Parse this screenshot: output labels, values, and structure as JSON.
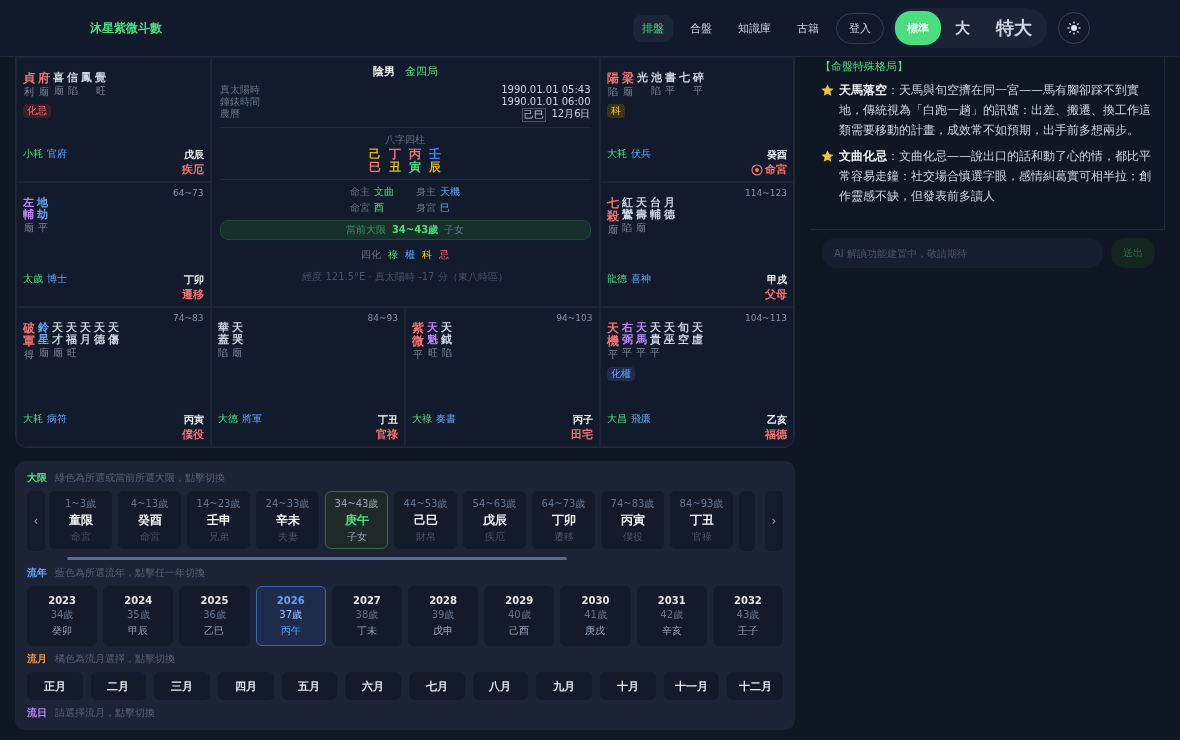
{
  "header": {
    "logo": "沐星紫微斗數",
    "nav": [
      {
        "label": "排盤",
        "selected": true
      },
      {
        "label": "合盤",
        "selected": false
      },
      {
        "label": "知識庫",
        "selected": false
      },
      {
        "label": "古籍",
        "selected": false
      }
    ],
    "login": "登入",
    "font_sizes": [
      {
        "label": "標準",
        "selected": true
      },
      {
        "label": "大",
        "selected": false
      },
      {
        "label": "特大",
        "selected": false
      }
    ]
  },
  "chart": {
    "palaces": [
      {
        "stars": [
          {
            "name": "貞",
            "kind": "main",
            "brightness": "利"
          },
          {
            "name": "府",
            "kind": "main",
            "brightness": "廟"
          },
          {
            "name": "喜",
            "kind": "minor",
            "brightness": "廟"
          },
          {
            "name": "信",
            "kind": "minor",
            "brightness": "陷"
          },
          {
            "name": "鳳",
            "kind": "minor"
          },
          {
            "name": "覺",
            "kind": "minor",
            "brightness": "旺"
          }
        ],
        "badge": {
          "text": "化忌",
          "kind": "ji"
        },
        "spirits": [
          "小耗",
          "官府"
        ],
        "stem_branch": "戊辰",
        "name": "疾厄",
        "life_palace": false
      },
      {
        "stars": [
          {
            "name": "陽",
            "kind": "main",
            "brightness": "陷"
          },
          {
            "name": "梁",
            "kind": "main",
            "brightness": "廟"
          },
          {
            "name": "光",
            "kind": "minor"
          },
          {
            "name": "池",
            "kind": "minor",
            "brightness": "陷"
          },
          {
            "name": "書",
            "kind": "minor",
            "brightness": "平"
          },
          {
            "name": "七",
            "kind": "minor"
          },
          {
            "name": "碎",
            "kind": "minor",
            "brightness": "平"
          }
        ],
        "badge": {
          "text": "科",
          "kind": "ke"
        },
        "spirits": [
          "大耗",
          "伏兵"
        ],
        "stem_branch": "癸酉",
        "name": "命宮",
        "life_palace": true
      },
      {
        "age": "64~73",
        "stars": [
          {
            "name": "左輔",
            "kind": "lucky",
            "brightness": "廟"
          },
          {
            "name": "地劫",
            "kind": "evil",
            "brightness": "平"
          }
        ],
        "spirits": [
          "太歲",
          "博士"
        ],
        "stem_branch": "丁卯",
        "name": "遷移",
        "life_palace": false
      },
      {
        "age": "114~123",
        "stars": [
          {
            "name": "七殺",
            "kind": "main",
            "brightness": "廟"
          },
          {
            "name": "紅鸞",
            "kind": "minor",
            "brightness": "陷"
          },
          {
            "name": "天壽",
            "kind": "minor",
            "brightness": "廟"
          },
          {
            "name": "台輔",
            "kind": "minor"
          },
          {
            "name": "月德",
            "kind": "minor"
          }
        ],
        "spirits": [
          "龍德",
          "喜神"
        ],
        "stem_branch": "甲戌",
        "name": "父母",
        "life_palace": false
      },
      {
        "age": "74~83",
        "stars": [
          {
            "name": "破軍",
            "kind": "main",
            "brightness": "得"
          },
          {
            "name": "鈴星",
            "kind": "evil",
            "brightness": "廟"
          },
          {
            "name": "天才",
            "kind": "minor",
            "brightness": "廟"
          },
          {
            "name": "天福",
            "kind": "minor",
            "brightness": "旺"
          },
          {
            "name": "天月",
            "kind": "minor"
          },
          {
            "name": "天德",
            "kind": "minor"
          },
          {
            "name": "天傷",
            "kind": "minor"
          }
        ],
        "spirits": [
          "大耗",
          "病符"
        ],
        "stem_branch": "丙寅",
        "name": "僕役",
        "life_palace": false
      },
      {
        "age": "84~93",
        "stars": [
          {
            "name": "華蓋",
            "kind": "minor",
            "brightness": "陷"
          },
          {
            "name": "天哭",
            "kind": "minor",
            "brightness": "廟"
          }
        ],
        "spirits": [
          "大德",
          "將軍"
        ],
        "stem_branch": "丁丑",
        "name": "官祿",
        "life_palace": false
      },
      {
        "age": "94~103",
        "stars": [
          {
            "name": "紫微",
            "kind": "main",
            "brightness": "平"
          },
          {
            "name": "天魁",
            "kind": "lucky",
            "brightness": "旺"
          },
          {
            "name": "天鉞",
            "kind": "minor",
            "brightness": "陷"
          }
        ],
        "spirits": [
          "大祿",
          "奏書"
        ],
        "stem_branch": "丙子",
        "name": "田宅",
        "life_palace": false
      },
      {
        "age": "104~113",
        "stars": [
          {
            "name": "天機",
            "kind": "main",
            "brightness": "平"
          },
          {
            "name": "右弼",
            "kind": "lucky",
            "brightness": "平"
          },
          {
            "name": "天馬",
            "kind": "lucky",
            "brightness": "平"
          },
          {
            "name": "天貴",
            "kind": "minor",
            "brightness": "平"
          },
          {
            "name": "天巫",
            "kind": "minor"
          },
          {
            "name": "旬空",
            "kind": "minor"
          },
          {
            "name": "天虛",
            "kind": "minor"
          }
        ],
        "badge": {
          "text": "化權",
          "kind": "quan"
        },
        "spirits": [
          "大昌",
          "飛廉"
        ],
        "stem_branch": "乙亥",
        "name": "福德",
        "life_palace": false
      }
    ],
    "center": {
      "gender": "陰男",
      "bureau": "金四局",
      "info": [
        {
          "label": "真太陽時",
          "value": "1990.01.01 05:43"
        },
        {
          "label": "鐘錶時間",
          "value": "1990.01.01 06:00"
        },
        {
          "label": "農曆",
          "year": "己巳",
          "value": "12月6日"
        }
      ],
      "bazi_title": "八字四柱",
      "pillars": [
        {
          "stem": {
            "text": "己",
            "color": "#eab308"
          },
          "branch": {
            "text": "巳",
            "color": "#f87171"
          }
        },
        {
          "stem": {
            "text": "丁",
            "color": "#f87171"
          },
          "branch": {
            "text": "丑",
            "color": "#eab308"
          }
        },
        {
          "stem": {
            "text": "丙",
            "color": "#f87171"
          },
          "branch": {
            "text": "寅",
            "color": "#4ade80"
          }
        },
        {
          "stem": {
            "text": "壬",
            "color": "#3b82f6"
          },
          "branch": {
            "text": "辰",
            "color": "#eab308"
          }
        }
      ],
      "masters": [
        {
          "label": "命主",
          "value": "文曲",
          "kind": "life"
        },
        {
          "label": "身主",
          "value": "天機",
          "kind": "body"
        },
        {
          "label": "命宮",
          "value": "酉",
          "kind": "life"
        },
        {
          "label": "身宮",
          "value": "巳",
          "kind": "body"
        }
      ],
      "current_decade": {
        "label": "當前大限",
        "range": "34~43歲",
        "palace": "子女"
      },
      "transforms": {
        "label": "四化",
        "items": [
          {
            "text": "祿",
            "kind": "lu"
          },
          {
            "text": "權",
            "kind": "quan"
          },
          {
            "text": "科",
            "kind": "ke"
          },
          {
            "text": "忌",
            "kind": "ji"
          }
        ]
      },
      "note": "經度 121.5°E · 真太陽時 -17 分（東八時區）"
    }
  },
  "reading": {
    "title": "【命盤特殊格局】",
    "items": [
      {
        "heading": "天馬落空",
        "text": "：天馬與旬空擠在同一宮——馬有腳卻踩不到實地，傳統視為「白跑一趟」的訊號：出差、搬遷、換工作這類需要移動的計畫，成效常不如預期，出手前多想兩步。"
      },
      {
        "heading": "文曲化忌",
        "text": "：文曲化忌——說出口的話和動了心的情，都比平常容易走鐘：社交場合慎選字眼，感情糾葛實可相半拉；創作靈感不缺，但發表前多讀人"
      }
    ]
  },
  "ai_input": {
    "placeholder": "AI 解讀功能建置中，敬請期待",
    "button": "送出"
  },
  "timeline": {
    "decades": {
      "label": "大限",
      "hint": "綠色為所選或當前所選大限，點擊切換",
      "items": [
        {
          "age": "1~3歲",
          "stem_branch": "童限",
          "palace": "命宮",
          "selected": false
        },
        {
          "age": "4~13歲",
          "stem_branch": "癸酉",
          "palace": "命宮",
          "selected": false
        },
        {
          "age": "14~23歲",
          "stem_branch": "壬申",
          "palace": "兄弟",
          "selected": false
        },
        {
          "age": "24~33歲",
          "stem_branch": "辛未",
          "palace": "夫妻",
          "selected": false
        },
        {
          "age": "34~43歲",
          "stem_branch": "庚午",
          "palace": "子女",
          "selected": true
        },
        {
          "age": "44~53歲",
          "stem_branch": "己巳",
          "palace": "財帛",
          "selected": false
        },
        {
          "age": "54~63歲",
          "stem_branch": "戊辰",
          "palace": "疾厄",
          "selected": false
        },
        {
          "age": "64~73歲",
          "stem_branch": "丁卯",
          "palace": "遷移",
          "selected": false
        },
        {
          "age": "74~83歲",
          "stem_branch": "丙寅",
          "palace": "僕役",
          "selected": false
        },
        {
          "age": "84~93歲",
          "stem_branch": "丁丑",
          "palace": "官祿",
          "selected": false
        }
      ],
      "prev": "‹",
      "next": "›"
    },
    "years": {
      "label": "流年",
      "hint": "藍色為所選流年，點擊任一年切換",
      "items": [
        {
          "year": "2023",
          "age": "34歲",
          "stem_branch": "癸卯",
          "selected": false
        },
        {
          "year": "2024",
          "age": "35歲",
          "stem_branch": "甲辰",
          "selected": false
        },
        {
          "year": "2025",
          "age": "36歲",
          "stem_branch": "乙巳",
          "selected": false
        },
        {
          "year": "2026",
          "age": "37歲",
          "stem_branch": "丙午",
          "selected": true
        },
        {
          "year": "2027",
          "age": "38歲",
          "stem_branch": "丁未",
          "selected": false
        },
        {
          "year": "2028",
          "age": "39歲",
          "stem_branch": "戊申",
          "selected": false
        },
        {
          "year": "2029",
          "age": "40歲",
          "stem_branch": "己酉",
          "selected": false
        },
        {
          "year": "2030",
          "age": "41歲",
          "stem_branch": "庚戌",
          "selected": false
        },
        {
          "year": "2031",
          "age": "42歲",
          "stem_branch": "辛亥",
          "selected": false
        },
        {
          "year": "2032",
          "age": "43歲",
          "stem_branch": "壬子",
          "selected": false
        }
      ]
    },
    "months": {
      "label": "流月",
      "hint": "橘色為流月選擇，點擊切換",
      "items": [
        "正月",
        "二月",
        "三月",
        "四月",
        "五月",
        "六月",
        "七月",
        "八月",
        "九月",
        "十月",
        "十一月",
        "十二月"
      ]
    },
    "days": {
      "label": "流日",
      "hint": "請選擇流月，點擊切換"
    }
  }
}
